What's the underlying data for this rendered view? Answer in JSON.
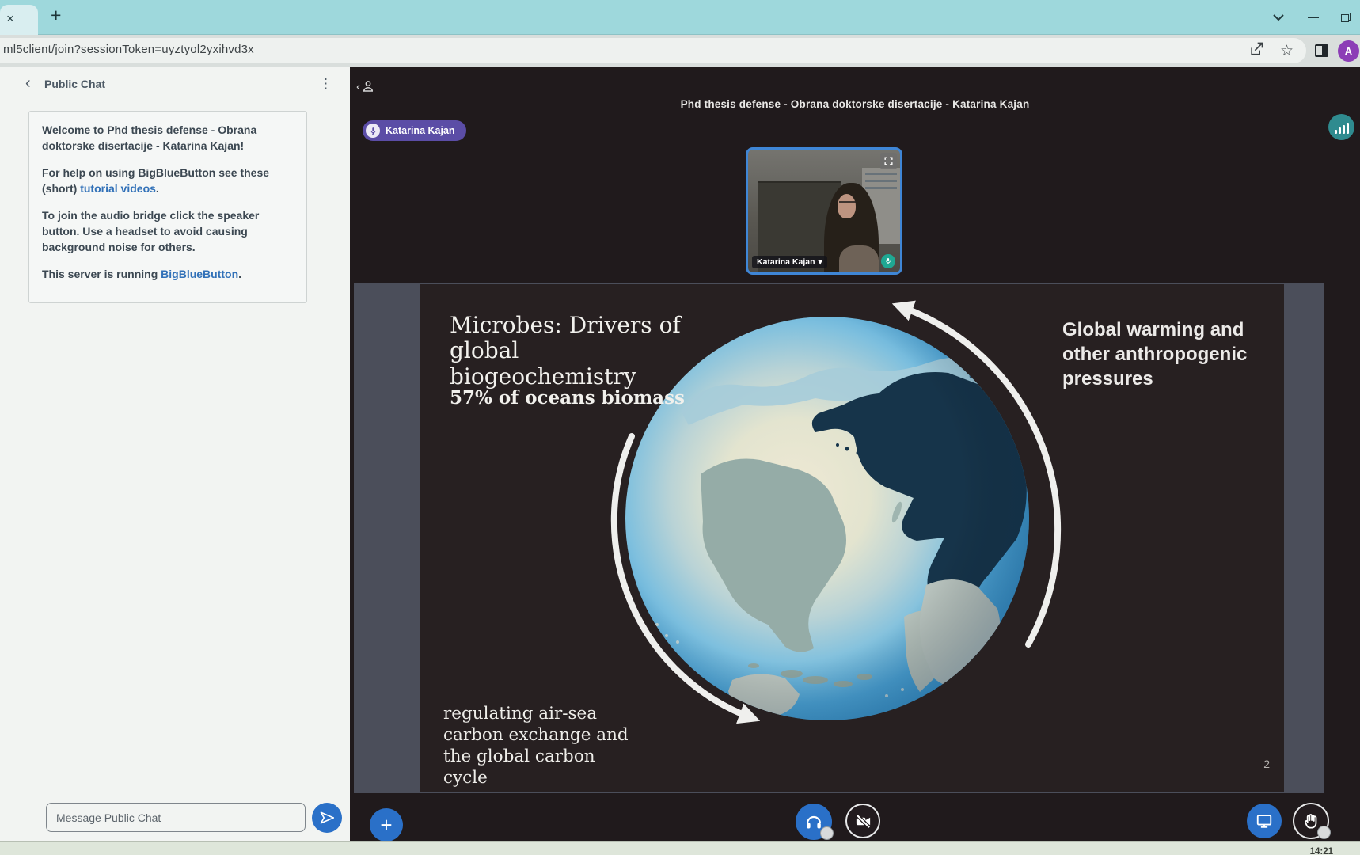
{
  "browser": {
    "url": "ml5client/join?sessionToken=uyztyol2yxihvd3x",
    "avatar_letter": "A"
  },
  "icons": {
    "tab_close": "×",
    "new_tab": "+",
    "back": "‹",
    "menu": "⋮",
    "star": "☆",
    "caret_down": "▾",
    "plus": "+"
  },
  "chat": {
    "title": "Public Chat",
    "messages": {
      "p1": [
        {
          "t": "Welcome to "
        },
        {
          "t": "Phd thesis defense - Obrana doktorske disertacije - Katarina Kajan!"
        }
      ],
      "p2": [
        {
          "t": "For help on using BigBlueButton see these (short) "
        },
        {
          "t": "tutorial videos"
        },
        {
          "t": "."
        }
      ],
      "p3": [
        {
          "t": "To join the audio bridge click the speaker button. Use a headset to avoid causing background noise for others."
        }
      ],
      "p4": [
        {
          "t": "This server is running "
        },
        {
          "t": "BigBlueButton"
        },
        {
          "t": "."
        }
      ]
    },
    "input_placeholder": "Message Public Chat"
  },
  "meeting": {
    "title": "Phd thesis defense - Obrana doktorske disertacije - Katarina Kajan",
    "talker": "Katarina Kajan",
    "webcam_name": "Katarina Kajan"
  },
  "slide": {
    "heading": "Microbes: Drivers of global biogeochemistry",
    "stat": "57% of oceans biomass",
    "right_note": "Global warming and other anthropogenic pressures",
    "bottom_note": "regulating air-sea carbon exchange and the global carbon cycle",
    "page_number": "2"
  },
  "taskbar": {
    "clock": "14:21"
  },
  "colors": {
    "accent_blue": "#2a70c8",
    "talker_purple": "#5b4da6",
    "link_blue": "#3171b8",
    "tab_teal": "#9ed8dc",
    "mic_teal": "#1fa893"
  }
}
